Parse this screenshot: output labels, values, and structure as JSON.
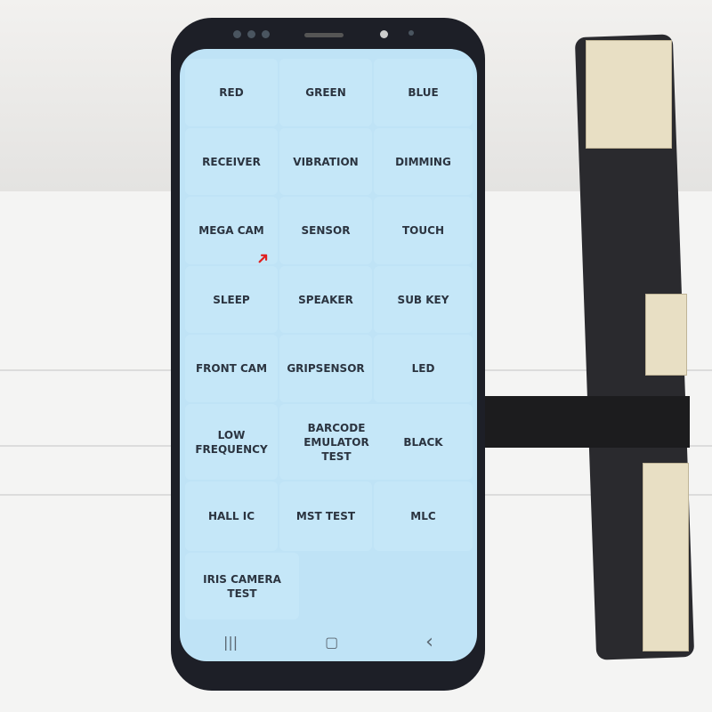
{
  "menu": {
    "items": [
      "RED",
      "GREEN",
      "BLUE",
      "RECEIVER",
      "VIBRATION",
      "DIMMING",
      "MEGA CAM",
      "SENSOR",
      "TOUCH",
      "SLEEP",
      "SPEAKER",
      "SUB KEY",
      "FRONT CAM",
      "GRIPSENSOR",
      "LED",
      "LOW FREQUENCY",
      "BARCODE EMULATOR TEST",
      "BLACK",
      "HALL IC",
      "MST TEST",
      "MLC",
      "IRIS CAMERA TEST"
    ]
  },
  "navbar": {
    "recents": "|||",
    "home": "▢",
    "back": "‹"
  },
  "colors": {
    "screen": "#bfe3f6",
    "text": "#2b3440",
    "pointer": "#e02020"
  }
}
